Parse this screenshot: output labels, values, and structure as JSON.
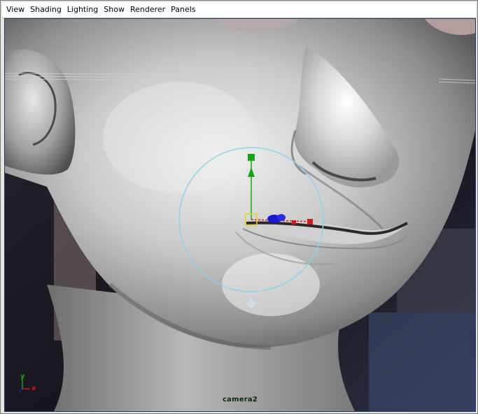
{
  "menu": {
    "items": [
      {
        "label": "View"
      },
      {
        "label": "Shading"
      },
      {
        "label": "Lighting"
      },
      {
        "label": "Show"
      },
      {
        "label": "Renderer"
      },
      {
        "label": "Panels"
      }
    ]
  },
  "viewport": {
    "camera_label": "camera2",
    "axis_labels": {
      "y": "y",
      "x": "x"
    }
  },
  "colors": {
    "manipulator_ring": "#8fd3e6",
    "y_axis": "#1aa31a",
    "x_axis": "#d11a1a",
    "z_axis": "#1a1ad1",
    "pivot": "#e8d21a"
  }
}
